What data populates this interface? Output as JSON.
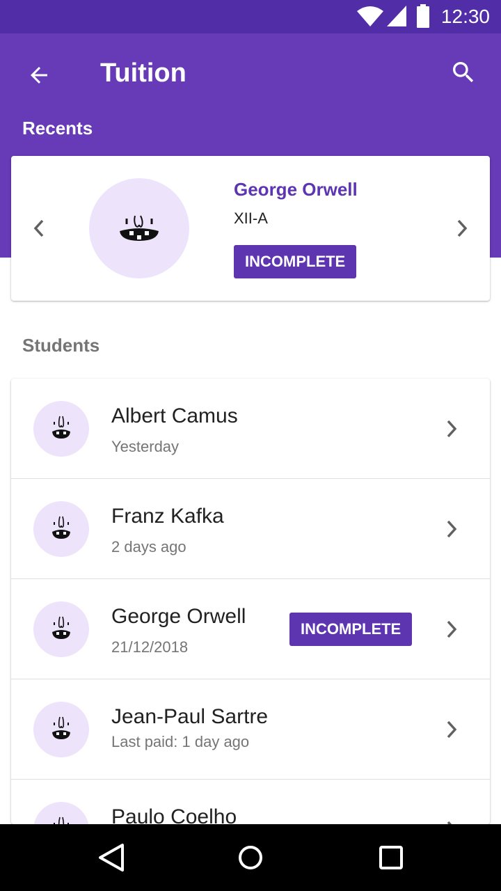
{
  "status_bar": {
    "time": "12:30"
  },
  "header": {
    "title": "Tuition",
    "back_icon": "arrow-back-icon",
    "search_icon": "search-icon"
  },
  "recents": {
    "section_label": "Recents",
    "card": {
      "name": "George Orwell",
      "class": "XII-A",
      "badge": "INCOMPLETE",
      "avatar_icon": "monster-face-icon"
    }
  },
  "students": {
    "section_label": "Students",
    "items": [
      {
        "name": "Albert Camus",
        "subtitle": "Yesterday"
      },
      {
        "name": "Franz Kafka",
        "subtitle": "2 days ago"
      },
      {
        "name": "George Orwell",
        "subtitle": "21/12/2018",
        "badge": "INCOMPLETE"
      },
      {
        "name": "Jean-Paul Sartre",
        "subtitle": "Last paid: 1 day ago"
      },
      {
        "name": "Paulo Coelho",
        "subtitle": ""
      }
    ]
  },
  "colors": {
    "status_bar": "#512da8",
    "app_bar": "#673ab7",
    "accent": "#5e35b1",
    "avatar_bg": "#ede4fb"
  }
}
